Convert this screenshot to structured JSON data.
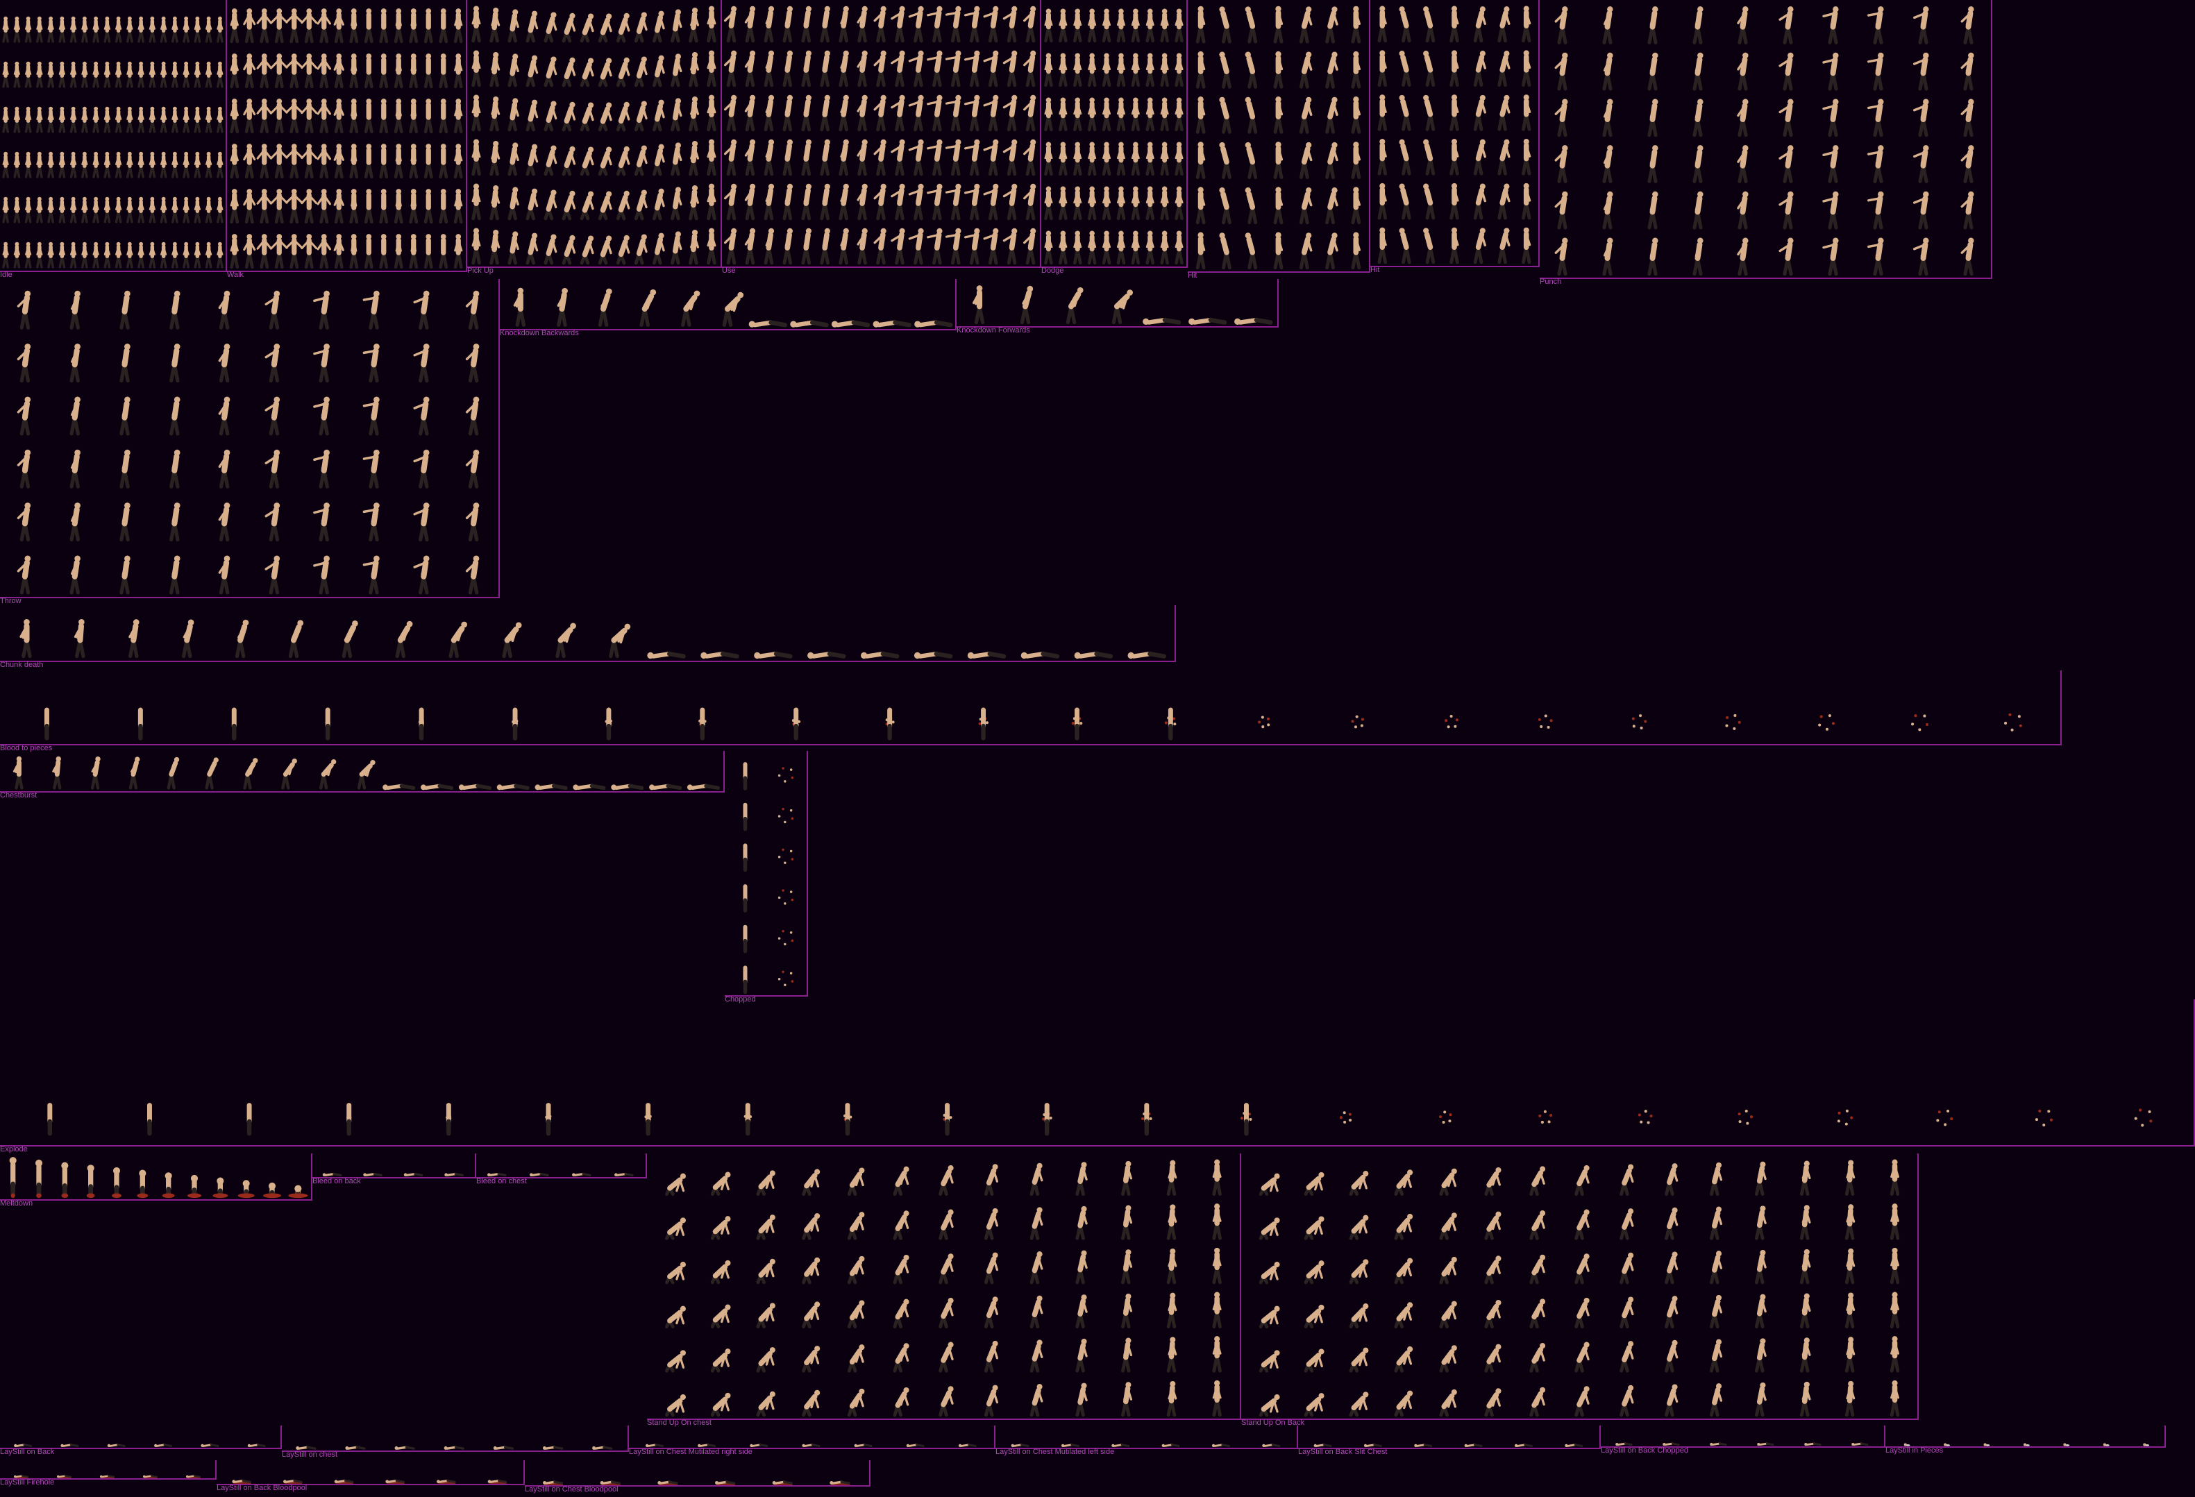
{
  "sheet": {
    "background": "#0b0010",
    "border_color": "#8a1f8f",
    "label_color": "#b04ab8",
    "figure_skin": "#d8b08c",
    "figure_pants": "#2a2220",
    "blood": "#9a2a1a",
    "animations": [
      {
        "id": "idle",
        "label": "Idle",
        "columns": 20,
        "rows": 6,
        "pose": "stand"
      },
      {
        "id": "walk",
        "label": "Walk",
        "columns": 16,
        "rows": 6,
        "pose": "walk"
      },
      {
        "id": "pickup",
        "label": "Pick Up",
        "columns": 14,
        "rows": 6,
        "pose": "crouch"
      },
      {
        "id": "use",
        "label": "Use",
        "columns": 17,
        "rows": 6,
        "pose": "reach"
      },
      {
        "id": "dodge",
        "label": "Dodge",
        "columns": 10,
        "rows": 6,
        "pose": "stand"
      },
      {
        "id": "hit",
        "label": "Hit",
        "columns": 7,
        "rows": 6,
        "pose": "flinch"
      },
      {
        "id": "hit2",
        "label": "Hit",
        "columns": 7,
        "rows": 6,
        "pose": "flinch"
      },
      {
        "id": "punch",
        "label": "Punch",
        "columns": 10,
        "rows": 6,
        "pose": "reach"
      },
      {
        "id": "throw",
        "label": "Throw",
        "columns": 10,
        "rows": 6,
        "pose": "reach"
      },
      {
        "id": "kd-back",
        "label": "Knockdown Backwards",
        "columns": 11,
        "rows": 1,
        "pose": "fall"
      },
      {
        "id": "kd-fwd",
        "label": "Knockdown Forwards",
        "columns": 7,
        "rows": 1,
        "pose": "fall"
      },
      {
        "id": "chunk",
        "label": "Chunk death",
        "columns": 22,
        "rows": 1,
        "pose": "fall"
      },
      {
        "id": "blood",
        "label": "Blood to pieces",
        "columns": 22,
        "rows": 1,
        "pose": "gore"
      },
      {
        "id": "chestburst",
        "label": "Chestburst",
        "columns": 19,
        "rows": 1,
        "pose": "fall"
      },
      {
        "id": "chopped",
        "label": "Chopped",
        "columns": 2,
        "rows": 6,
        "pose": "gore"
      },
      {
        "id": "explode",
        "label": "Explode",
        "columns": 22,
        "rows": 1,
        "pose": "gore"
      },
      {
        "id": "meltdown",
        "label": "Meltdown",
        "columns": 12,
        "rows": 1,
        "pose": "melt"
      },
      {
        "id": "bleed-back",
        "label": "Bleed on back",
        "columns": 4,
        "rows": 1,
        "pose": "lie"
      },
      {
        "id": "bleed-chest",
        "label": "Bleed on chest",
        "columns": 4,
        "rows": 1,
        "pose": "lie"
      },
      {
        "id": "standup-chest",
        "label": "Stand Up On chest",
        "columns": 13,
        "rows": 6,
        "pose": "rise"
      },
      {
        "id": "standup-back",
        "label": "Stand Up On Back",
        "columns": 15,
        "rows": 6,
        "pose": "rise"
      },
      {
        "id": "ls-back",
        "label": "LayStill on Back",
        "columns": 6,
        "rows": 1,
        "pose": "lie"
      },
      {
        "id": "ls-chest",
        "label": "LayStill on chest",
        "columns": 7,
        "rows": 1,
        "pose": "lie"
      },
      {
        "id": "ls-chest-mr",
        "label": "LayStill on Chest Mutilated right side",
        "columns": 7,
        "rows": 1,
        "pose": "lie"
      },
      {
        "id": "ls-chest-ml",
        "label": "LayStill on Chest Mutilated left side",
        "columns": 6,
        "rows": 1,
        "pose": "lie"
      },
      {
        "id": "ls-back-slit",
        "label": "LayStill on Back Slit Chest",
        "columns": 6,
        "rows": 1,
        "pose": "lie"
      },
      {
        "id": "ls-back-chopped",
        "label": "LayStill on Back Chopped",
        "columns": 6,
        "rows": 1,
        "pose": "lie"
      },
      {
        "id": "ls-pieces",
        "label": "LayStill in Pieces",
        "columns": 7,
        "rows": 1,
        "pose": "bits"
      },
      {
        "id": "ls-firehole",
        "label": "LayStill Firehole",
        "columns": 5,
        "rows": 1,
        "pose": "pool"
      },
      {
        "id": "ls-back-pool",
        "label": "LayStill on Back Bloodpool",
        "columns": 6,
        "rows": 1,
        "pose": "pool"
      },
      {
        "id": "ls-chest-pool",
        "label": "LayStill on Chest Bloodpool",
        "columns": 6,
        "rows": 1,
        "pose": "pool"
      }
    ]
  }
}
